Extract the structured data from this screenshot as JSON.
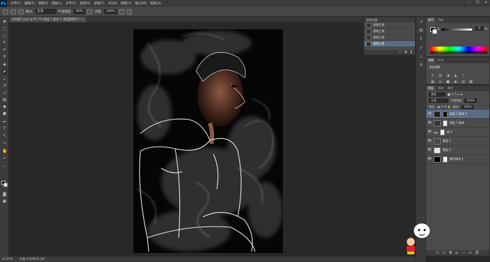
{
  "menubar": {
    "logo": "Ps",
    "items": [
      "文件(F)",
      "编辑(E)",
      "图像(I)",
      "图层(L)",
      "文字(Y)",
      "选择(S)",
      "滤镜(T)",
      "3D(D)",
      "视图(V)",
      "窗口(W)",
      "帮助(H)"
    ],
    "window_controls": [
      "—",
      "❐",
      "✕"
    ]
  },
  "options": {
    "mode_label": "模式:",
    "mode_value": "正常",
    "opacity_label": "不透明度:",
    "opacity_value": "92%",
    "flow_label": "流量:",
    "flow_value": "100%"
  },
  "document": {
    "tab_title": "无标题-1.psd @ 41.7% (图层 1 副本 3, 图层蒙版/8) * ×"
  },
  "status": {
    "zoom": "41.67%",
    "doc_size": "文档:5.93M/25.1M"
  },
  "history": {
    "title": "历史记录",
    "items": [
      "画笔工具",
      "画笔工具",
      "画笔工具",
      "画笔工具"
    ],
    "selected_index": 3
  },
  "color": {
    "tabs": [
      "颜色",
      "色板"
    ],
    "channel": "K",
    "value": "0",
    "unit": "%"
  },
  "adjustments": {
    "tabs": [
      "调整",
      "样式"
    ],
    "title": "添加调整",
    "row1": [
      "☀",
      "▥",
      "◪",
      "▲",
      "▽"
    ],
    "row2": [
      "▦",
      "⚖",
      "■",
      "◉",
      "▧",
      "▩"
    ],
    "row3": [
      "◐",
      "◑",
      "▤",
      "✕",
      "◻"
    ]
  },
  "layers": {
    "tabs": [
      "图层",
      "通道",
      "路径"
    ],
    "kind_label": "类型",
    "blend_mode": "正常",
    "opacity_label": "不透明度:",
    "opacity": "100%",
    "lock_label": "锁定:",
    "fill_label": "填充:",
    "fill": "100%",
    "items": [
      {
        "name": "图层 1 副本 3",
        "selected": true,
        "thumb": "#222",
        "mask": "#111"
      },
      {
        "name": "图层 1 副本",
        "selected": false,
        "thumb": "#333",
        "mask": "#eee"
      },
      {
        "name": "组 1",
        "selected": false,
        "thumb": "#555",
        "mask": "#eee"
      },
      {
        "name": "图层 1",
        "selected": false,
        "thumb": "#444",
        "mask": ""
      },
      {
        "name": "图层 2",
        "selected": false,
        "thumb": "#e8e8e8",
        "mask": ""
      },
      {
        "name": "颜色填充 1",
        "selected": false,
        "thumb": "#000",
        "mask": "#fff"
      }
    ],
    "footer_icons": [
      "⊖",
      "fx",
      "◘",
      "◍",
      "▭",
      "⊞",
      "🗑"
    ]
  }
}
